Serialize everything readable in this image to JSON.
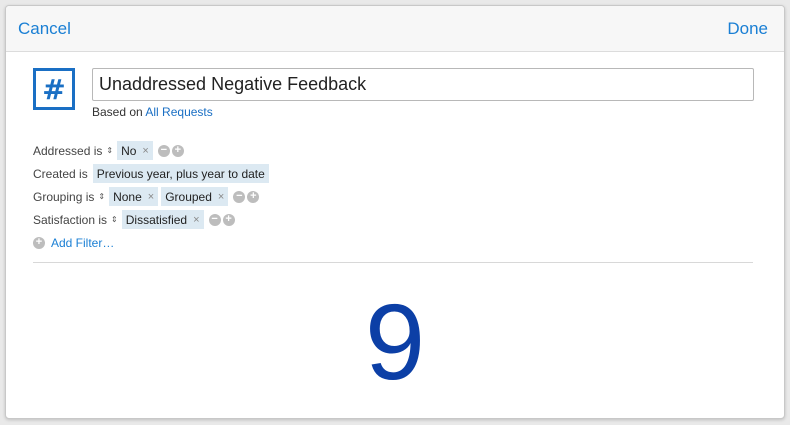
{
  "toolbar": {
    "cancel_label": "Cancel",
    "done_label": "Done"
  },
  "widget": {
    "icon_glyph": "#",
    "title": "Unaddressed Negative Feedback",
    "based_on_prefix": "Based on",
    "based_on_link": "All Requests"
  },
  "filters": [
    {
      "label": "Addressed is",
      "values": [
        "No"
      ]
    },
    {
      "label": "Created is",
      "values": [
        "Previous year, plus year to date"
      ]
    },
    {
      "label": "Grouping is",
      "values": [
        "None",
        "Grouped"
      ]
    },
    {
      "label": "Satisfaction is",
      "values": [
        "Dissatisfied"
      ]
    }
  ],
  "add_filter_label": "Add Filter…",
  "result": {
    "value": "9"
  },
  "colors": {
    "accent": "#1a7fd4",
    "number": "#0c3fa6",
    "chip_bg": "#dce9f2"
  }
}
